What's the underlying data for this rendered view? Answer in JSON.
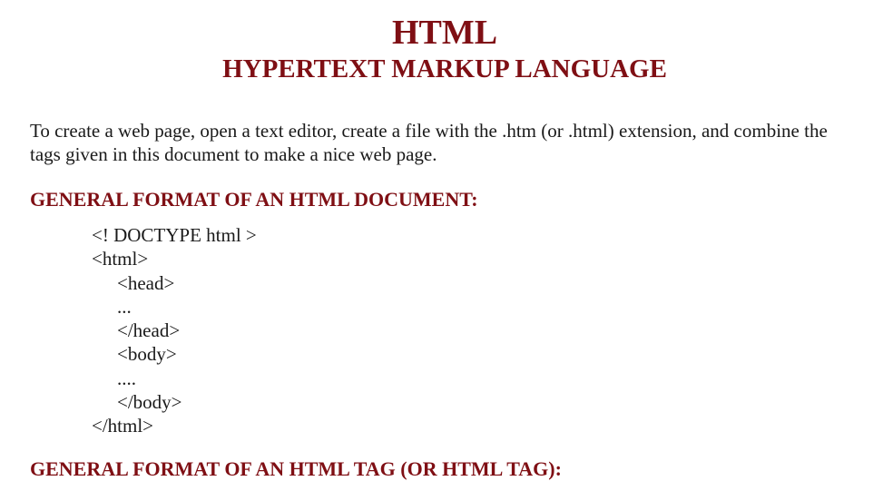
{
  "document": {
    "title": "HTML",
    "subtitle": "HYPERTEXT MARKUP LANGUAGE",
    "intro": "To create a web page, open a text editor, create a file with the .htm (or .html) extension, and combine the tags given in this document to make a nice web page.",
    "sections": [
      {
        "heading": "GENERAL FORMAT OF AN HTML DOCUMENT:",
        "code_lines": [
          {
            "text": "<! DOCTYPE html >",
            "indent": 0
          },
          {
            "text": "<html>",
            "indent": 0
          },
          {
            "text": "<head>",
            "indent": 1
          },
          {
            "text": "...",
            "indent": 1
          },
          {
            "text": "</head>",
            "indent": 1
          },
          {
            "text": "<body>",
            "indent": 1
          },
          {
            "text": "....",
            "indent": 1
          },
          {
            "text": "</body>",
            "indent": 1
          },
          {
            "text": "</html>",
            "indent": 0
          }
        ]
      },
      {
        "heading": "GENERAL FORMAT OF AN HTML TAG (OR HTML TAG):"
      }
    ]
  },
  "colors": {
    "heading": "#7f0f14",
    "body_text": "#1a1a1a",
    "background": "#ffffff"
  }
}
